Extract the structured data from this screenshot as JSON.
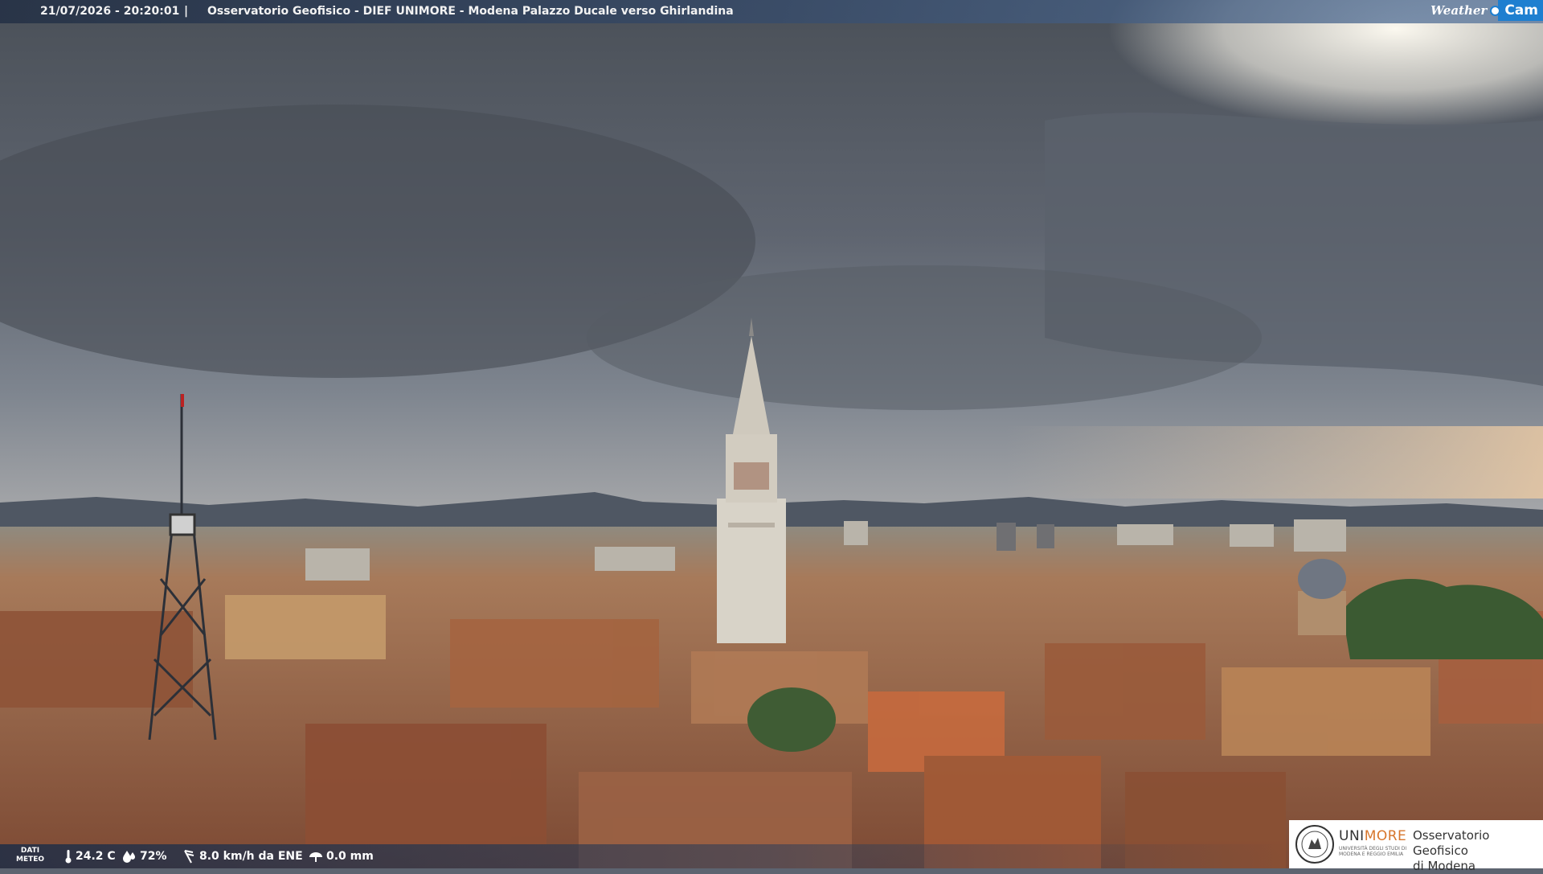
{
  "header": {
    "timestamp": "21/07/2026 - 20:20:01",
    "separator": "|",
    "location": "Osservatorio Geofisico - DIEF UNIMORE - Modena Palazzo Ducale verso Ghirlandina"
  },
  "brand": {
    "weather": "Weather",
    "cam": "Cam"
  },
  "weather": {
    "label_line1": "DATI",
    "label_line2": "METEO",
    "temperature": "24.2 C",
    "humidity": "72%",
    "wind": "8.0 km/h da ENE",
    "rain": "0.0 mm",
    "icons": [
      "thermometer-icon",
      "humidity-drop-icon",
      "wind-icon",
      "rain-gauge-icon"
    ]
  },
  "logo": {
    "uni_prefix": "UNI",
    "uni_suffix": "MORE",
    "uni_sub_line1": "UNIVERSITÀ DEGLI STUDI DI",
    "uni_sub_line2": "MODENA E REGGIO EMILIA",
    "observatory_line1": "Osservatorio Geofisico",
    "observatory_line2": "di Modena",
    "accent_color": "#d7762c"
  },
  "scene": {
    "subject": "webcam view over Modena rooftops with Ghirlandina tower",
    "sky_colors": [
      "#4c525c",
      "#6a707a",
      "#f3f1ea"
    ],
    "roof_color": "#a45e3e"
  }
}
